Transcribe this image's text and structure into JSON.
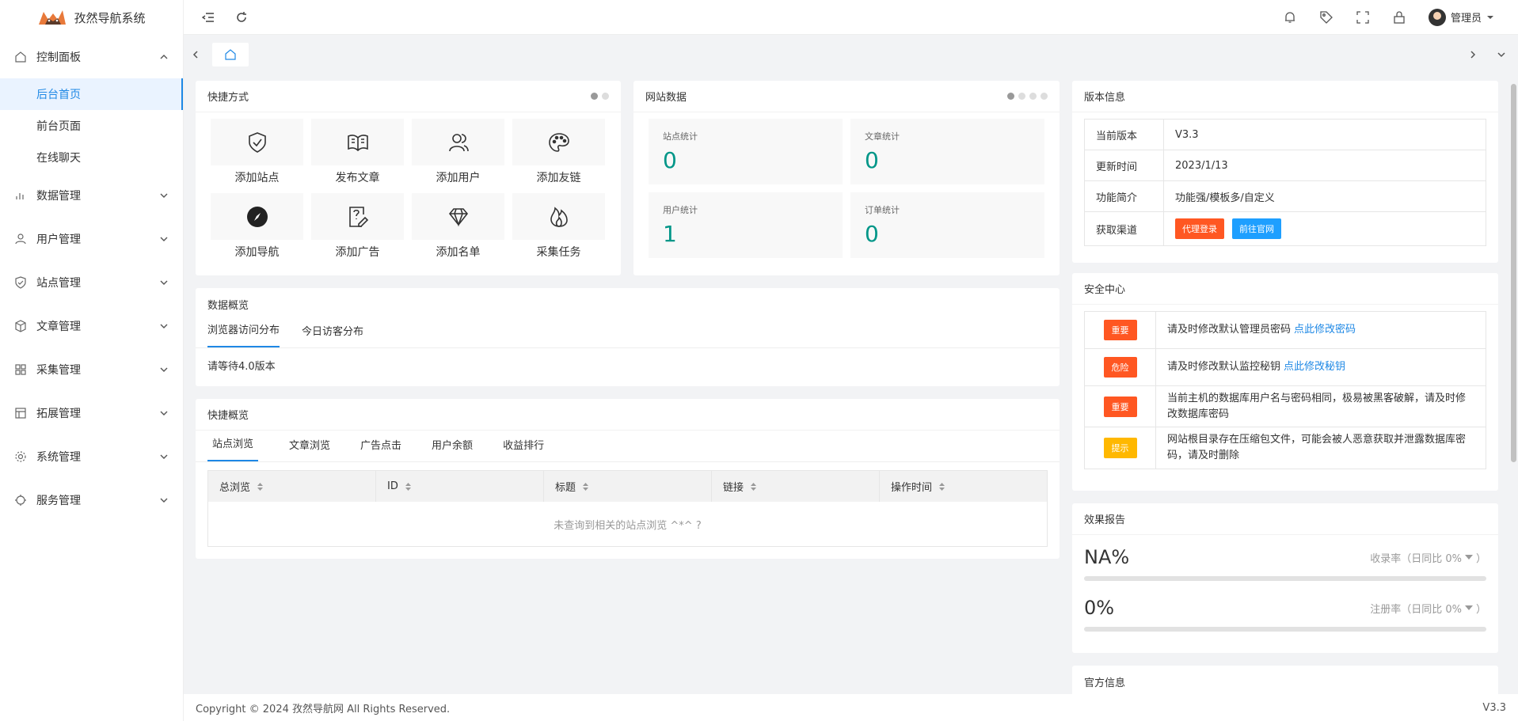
{
  "brand": {
    "title": "孜然导航系统"
  },
  "sidebar": {
    "groups": [
      {
        "label": "控制面板",
        "icon": "home-icon",
        "open": true,
        "children": [
          {
            "label": "后台首页",
            "active": true
          },
          {
            "label": "前台页面"
          },
          {
            "label": "在线聊天"
          }
        ]
      },
      {
        "label": "数据管理",
        "icon": "data-icon"
      },
      {
        "label": "用户管理",
        "icon": "user-icon"
      },
      {
        "label": "站点管理",
        "icon": "shield-icon"
      },
      {
        "label": "文章管理",
        "icon": "cube-icon"
      },
      {
        "label": "采集管理",
        "icon": "apps-icon"
      },
      {
        "label": "拓展管理",
        "icon": "extend-icon"
      },
      {
        "label": "系统管理",
        "icon": "gear-icon"
      },
      {
        "label": "服务管理",
        "icon": "service-icon"
      }
    ]
  },
  "topbar": {
    "user_name": "管理员"
  },
  "shortcuts": {
    "title": "快捷方式",
    "items": [
      {
        "label": "添加站点",
        "icon": "shield-check-icon"
      },
      {
        "label": "发布文章",
        "icon": "book-icon"
      },
      {
        "label": "添加用户",
        "icon": "users-icon"
      },
      {
        "label": "添加友链",
        "icon": "palette-icon"
      },
      {
        "label": "添加导航",
        "icon": "compass-icon"
      },
      {
        "label": "添加广告",
        "icon": "edit-doc-icon"
      },
      {
        "label": "添加名单",
        "icon": "diamond-icon"
      },
      {
        "label": "采集任务",
        "icon": "fire-icon"
      }
    ]
  },
  "site_data": {
    "title": "网站数据",
    "stats": [
      {
        "label": "站点统计",
        "value": "0"
      },
      {
        "label": "文章统计",
        "value": "0"
      },
      {
        "label": "用户统计",
        "value": "1"
      },
      {
        "label": "订单统计",
        "value": "0"
      }
    ]
  },
  "version_info": {
    "title": "版本信息",
    "rows": [
      {
        "key": "当前版本",
        "value": "V3.3"
      },
      {
        "key": "更新时间",
        "value": "2023/1/13"
      },
      {
        "key": "功能简介",
        "value": "功能强/模板多/自定义"
      }
    ],
    "channel_key": "获取渠道",
    "btn_agent": "代理登录",
    "btn_official": "前往官网"
  },
  "overview": {
    "title": "数据概览",
    "tabs": [
      "浏览器访问分布",
      "今日访客分布"
    ],
    "notice": "请等待4.0版本"
  },
  "quick_overview": {
    "title": "快捷概览",
    "tabs": [
      "站点浏览",
      "文章浏览",
      "广告点击",
      "用户余额",
      "收益排行"
    ],
    "columns": [
      "总浏览",
      "ID",
      "标题",
      "链接",
      "操作时间"
    ],
    "empty": "未查询到相关的站点浏览 ^*^ ?"
  },
  "security": {
    "title": "安全中心",
    "rows": [
      {
        "tag": "重要",
        "color": "#ff5722",
        "text": "请及时修改默认管理员密码",
        "link": "点此修改密码"
      },
      {
        "tag": "危险",
        "color": "#ff5722",
        "text": "请及时修改默认监控秘钥",
        "link": "点此修改秘钥"
      },
      {
        "tag": "重要",
        "color": "#ff5722",
        "text": "当前主机的数据库用户名与密码相同，极易被黑客破解，请及时修改数据库密码",
        "link": ""
      },
      {
        "tag": "提示",
        "color": "#ffb800",
        "text": "网站根目录存在压缩包文件，可能会被人恶意获取并泄露数据库密码，请及时删除",
        "link": ""
      }
    ]
  },
  "report": {
    "title": "效果报告",
    "items": [
      {
        "value": "NA%",
        "caption": "收录率（日同比 0%",
        "progress": 0
      },
      {
        "value": "0%",
        "caption": "注册率（日同比 0%",
        "progress": 0
      }
    ]
  },
  "official": {
    "title": "官方信息"
  },
  "footer": {
    "copyright": "Copyright © 2024 孜然导航网 All Rights Reserved.",
    "version": "V3.3"
  }
}
